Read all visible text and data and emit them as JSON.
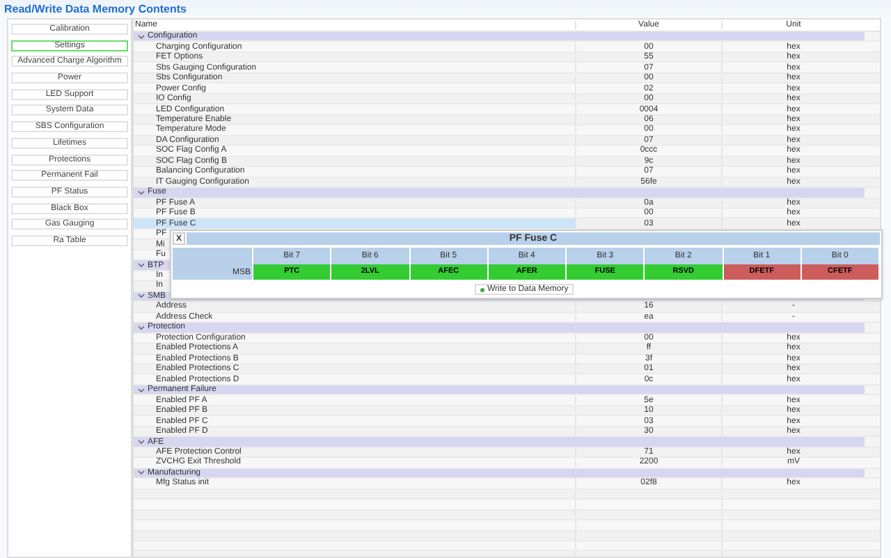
{
  "title": "Read/Write Data Memory Contents",
  "sidebar": {
    "items": [
      {
        "label": "Calibration",
        "selected": false
      },
      {
        "label": "Settings",
        "selected": true
      },
      {
        "label": "Advanced Charge Algorithm",
        "selected": false
      },
      {
        "label": "Power",
        "selected": false
      },
      {
        "label": "LED Support",
        "selected": false
      },
      {
        "label": "System Data",
        "selected": false
      },
      {
        "label": "SBS Configuration",
        "selected": false
      },
      {
        "label": "Lifetimes",
        "selected": false
      },
      {
        "label": "Protections",
        "selected": false
      },
      {
        "label": "Permanent Fail",
        "selected": false
      },
      {
        "label": "PF Status",
        "selected": false
      },
      {
        "label": "Black Box",
        "selected": false
      },
      {
        "label": "Gas Gauging",
        "selected": false
      },
      {
        "label": "Ra Table",
        "selected": false
      }
    ]
  },
  "table": {
    "columns": [
      "Name",
      "Value",
      "Unit"
    ],
    "sections": [
      {
        "name": "Configuration",
        "expanded": true,
        "rows": [
          {
            "name": "Charging Configuration",
            "value": "00",
            "unit": "hex",
            "selected": false
          },
          {
            "name": "FET Options",
            "value": "55",
            "unit": "hex",
            "selected": false
          },
          {
            "name": "Sbs Gauging Configuration",
            "value": "07",
            "unit": "hex",
            "selected": false
          },
          {
            "name": "Sbs Configuration",
            "value": "00",
            "unit": "hex",
            "selected": false
          },
          {
            "name": "Power Config",
            "value": "02",
            "unit": "hex",
            "selected": false
          },
          {
            "name": "IO Config",
            "value": "00",
            "unit": "hex",
            "selected": false
          },
          {
            "name": "LED Configuration",
            "value": "0004",
            "unit": "hex",
            "selected": false
          },
          {
            "name": "Temperature Enable",
            "value": "06",
            "unit": "hex",
            "selected": false
          },
          {
            "name": "Temperature Mode",
            "value": "00",
            "unit": "hex",
            "selected": false
          },
          {
            "name": "DA Configuration",
            "value": "07",
            "unit": "hex",
            "selected": false
          },
          {
            "name": "SOC Flag Config A",
            "value": "0ccc",
            "unit": "hex",
            "selected": false
          },
          {
            "name": "SOC Flag Config B",
            "value": "9c",
            "unit": "hex",
            "selected": false
          },
          {
            "name": "Balancing Configuration",
            "value": "07",
            "unit": "hex",
            "selected": false
          },
          {
            "name": "IT Gauging Configuration",
            "value": "56fe",
            "unit": "hex",
            "selected": false
          }
        ]
      },
      {
        "name": "Fuse",
        "expanded": true,
        "rows": [
          {
            "name": "PF Fuse A",
            "value": "0a",
            "unit": "hex",
            "selected": false
          },
          {
            "name": "PF Fuse B",
            "value": "00",
            "unit": "hex",
            "selected": false
          },
          {
            "name": "PF Fuse C",
            "value": "03",
            "unit": "hex",
            "selected": true
          },
          {
            "name": "PF",
            "selected": false
          },
          {
            "name": "Mi",
            "selected": false
          },
          {
            "name": "Fu",
            "selected": false
          }
        ]
      },
      {
        "name": "BTP",
        "expanded": true,
        "rows": [
          {
            "name": "In",
            "selected": false
          },
          {
            "name": "In",
            "selected": false
          }
        ]
      },
      {
        "name": "SMB",
        "expanded": true,
        "rows": [
          {
            "name": "Address",
            "value": "16",
            "unit": "-",
            "selected": false
          },
          {
            "name": "Address Check",
            "value": "ea",
            "unit": "-",
            "selected": false
          }
        ]
      },
      {
        "name": "Protection",
        "expanded": true,
        "rows": [
          {
            "name": "Protection Configuration",
            "value": "00",
            "unit": "hex",
            "selected": false
          },
          {
            "name": "Enabled Protections A",
            "value": "ff",
            "unit": "hex",
            "selected": false
          },
          {
            "name": "Enabled Protections B",
            "value": "3f",
            "unit": "hex",
            "selected": false
          },
          {
            "name": "Enabled Protections C",
            "value": "01",
            "unit": "hex",
            "selected": false
          },
          {
            "name": "Enabled Protections D",
            "value": "0c",
            "unit": "hex",
            "selected": false
          }
        ]
      },
      {
        "name": "Permanent Failure",
        "expanded": true,
        "rows": [
          {
            "name": "Enabled PF A",
            "value": "5e",
            "unit": "hex",
            "selected": false
          },
          {
            "name": "Enabled PF B",
            "value": "10",
            "unit": "hex",
            "selected": false
          },
          {
            "name": "Enabled PF C",
            "value": "03",
            "unit": "hex",
            "selected": false
          },
          {
            "name": "Enabled PF D",
            "value": "30",
            "unit": "hex",
            "selected": false
          }
        ]
      },
      {
        "name": "AFE",
        "expanded": true,
        "rows": [
          {
            "name": "AFE Protection Control",
            "value": "71",
            "unit": "hex",
            "selected": false
          },
          {
            "name": "ZVCHG Exit Threshold",
            "value": "2200",
            "unit": "mV",
            "selected": false
          }
        ]
      },
      {
        "name": "Manufacturing",
        "expanded": true,
        "rows": [
          {
            "name": "Mfg Status init",
            "value": "02f8",
            "unit": "hex",
            "selected": false
          }
        ]
      }
    ]
  },
  "popup": {
    "close": "X",
    "title": "PF Fuse C",
    "row_label": "MSB",
    "bits": [
      {
        "header": "Bit 7",
        "name": "PTC",
        "color": "#33cc33"
      },
      {
        "header": "Bit 6",
        "name": "2LVL",
        "color": "#33cc33"
      },
      {
        "header": "Bit 5",
        "name": "AFEC",
        "color": "#33cc33"
      },
      {
        "header": "Bit 4",
        "name": "AFER",
        "color": "#33cc33"
      },
      {
        "header": "Bit 3",
        "name": "FUSE",
        "color": "#33cc33"
      },
      {
        "header": "Bit 2",
        "name": "RSVD",
        "color": "#33cc33"
      },
      {
        "header": "Bit 1",
        "name": "DFETF",
        "color": "#cd5c5c"
      },
      {
        "header": "Bit 0",
        "name": "CFETF",
        "color": "#cd5c5c"
      }
    ],
    "button": "Write to Data Memory"
  }
}
